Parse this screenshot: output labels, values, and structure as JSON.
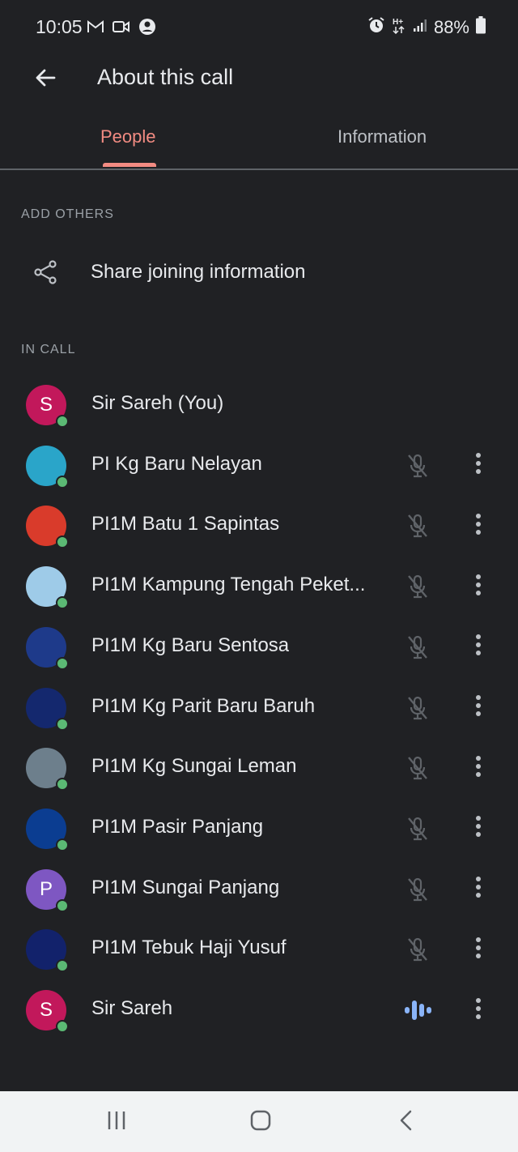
{
  "status_bar": {
    "time": "10:05",
    "battery": "88%",
    "icons": [
      "gmail-icon",
      "video-icon",
      "account-icon",
      "alarm-icon",
      "hplus-data-icon",
      "signal-icon",
      "battery-icon"
    ]
  },
  "app_bar": {
    "title": "About this call",
    "back_icon": "arrow-back-icon"
  },
  "tabs": [
    {
      "label": "People",
      "selected": true
    },
    {
      "label": "Information",
      "selected": false
    }
  ],
  "add_others": {
    "header": "ADD OTHERS",
    "share_label": "Share joining information",
    "share_icon": "share-icon"
  },
  "in_call": {
    "header": "IN CALL",
    "participants": [
      {
        "name": "Sir Sareh (You)",
        "avatar_letter": "S",
        "avatar_color": "#c2185b",
        "mic": "none",
        "has_menu": false
      },
      {
        "name": "PI Kg Baru Nelayan",
        "avatar_letter": "",
        "avatar_color": "#2aa5c9",
        "mic": "muted",
        "has_menu": true
      },
      {
        "name": "PI1M Batu 1 Sapintas",
        "avatar_letter": "",
        "avatar_color": "#d93b2b",
        "mic": "muted",
        "has_menu": true
      },
      {
        "name": "PI1M Kampung Tengah Peket...",
        "avatar_letter": "",
        "avatar_color": "#9ecbe8",
        "mic": "muted",
        "has_menu": true
      },
      {
        "name": "PI1M Kg Baru Sentosa",
        "avatar_letter": "",
        "avatar_color": "#1e3a8a",
        "mic": "muted",
        "has_menu": true
      },
      {
        "name": "PI1M Kg Parit Baru Baruh",
        "avatar_letter": "",
        "avatar_color": "#14286e",
        "mic": "muted",
        "has_menu": true
      },
      {
        "name": "PI1M Kg Sungai Leman",
        "avatar_letter": "",
        "avatar_color": "#6d7f8c",
        "mic": "muted",
        "has_menu": true
      },
      {
        "name": "PI1M Pasir Panjang",
        "avatar_letter": "",
        "avatar_color": "#0b3d91",
        "mic": "muted",
        "has_menu": true
      },
      {
        "name": "PI1M Sungai Panjang",
        "avatar_letter": "P",
        "avatar_color": "#7e57c2",
        "mic": "muted",
        "has_menu": true
      },
      {
        "name": "PI1M Tebuk Haji Yusuf",
        "avatar_letter": "",
        "avatar_color": "#12226b",
        "mic": "muted",
        "has_menu": true
      },
      {
        "name": "Sir Sareh",
        "avatar_letter": "S",
        "avatar_color": "#c2185b",
        "mic": "speaking",
        "has_menu": true
      }
    ]
  },
  "nav_bar": {
    "buttons": [
      "recent-apps-icon",
      "home-icon",
      "back-icon"
    ]
  }
}
